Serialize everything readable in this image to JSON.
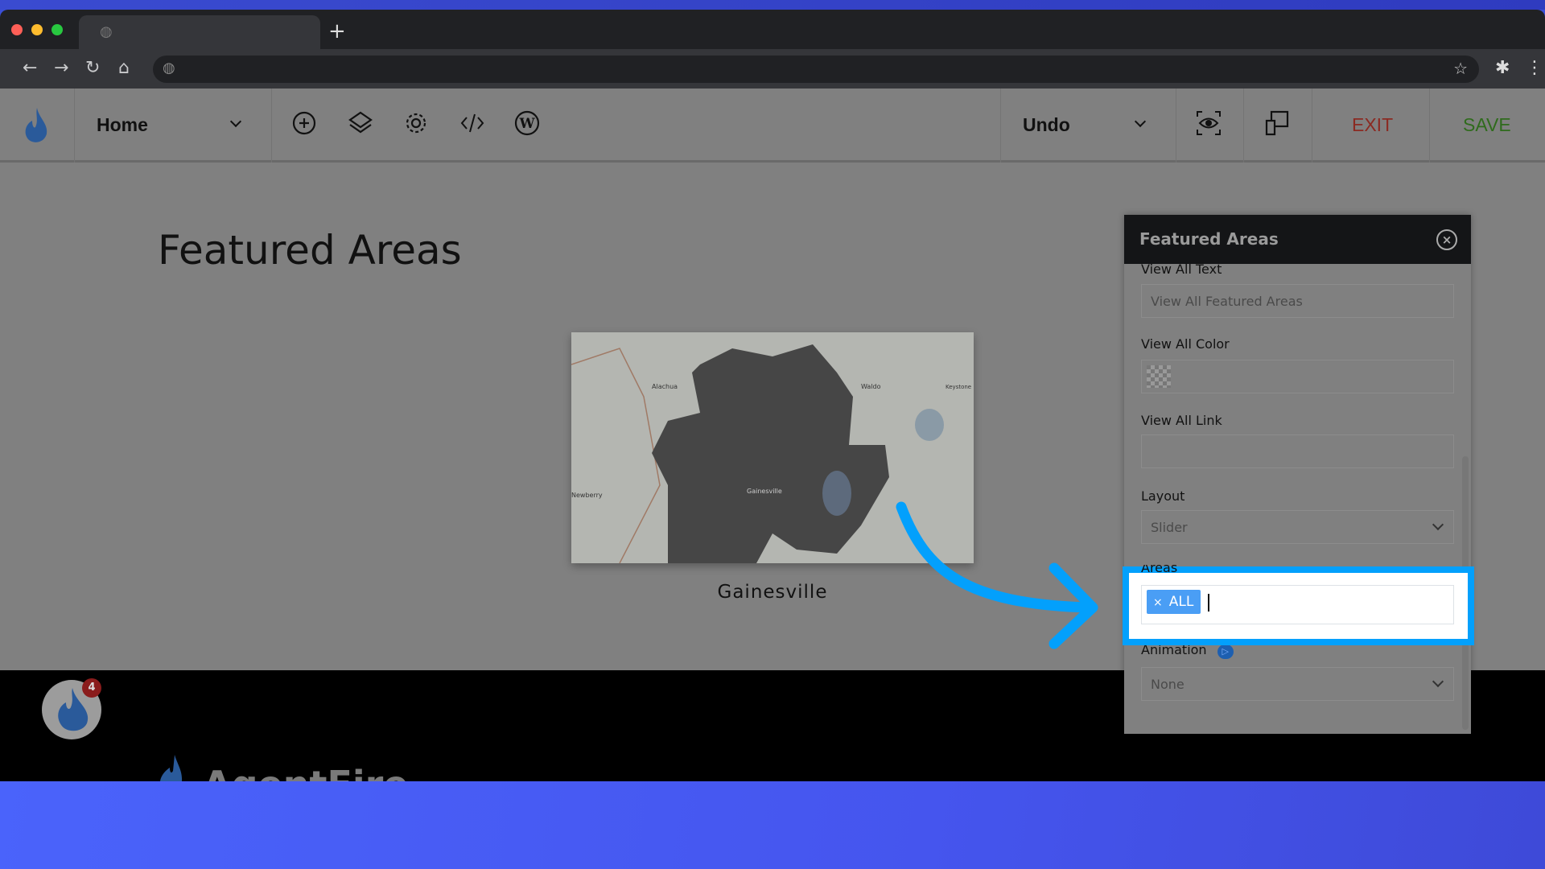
{
  "browser": {
    "new_tab": "+"
  },
  "toolbar": {
    "page": "Home",
    "undo": "Undo",
    "exit": "EXIT",
    "save": "SAVE",
    "exit_color": "#8b2a22",
    "save_color": "#2f6b1c",
    "icons": [
      "plus-circle-icon",
      "layers-icon",
      "gear-icon",
      "code-icon",
      "wordpress-icon",
      "preview-eye-icon",
      "responsive-icon"
    ]
  },
  "main": {
    "title": "Featured Areas",
    "area_name": "Gainesville",
    "map_labels": [
      "Alachua",
      "Waldo",
      "Keystone Heights",
      "Newberry",
      "Gainesville"
    ]
  },
  "panel": {
    "title": "Featured Areas",
    "view_all_text_label": "View All Text",
    "view_all_text_value": "View All Featured Areas",
    "view_all_color_label": "View All Color",
    "view_all_link_label": "View All Link",
    "view_all_link_value": "",
    "layout_label": "Layout",
    "layout_value": "Slider",
    "areas_label": "Areas",
    "areas_chip": "ALL",
    "chip_remove": "×",
    "animation_label": "Animation",
    "animation_value": "None",
    "highlight_color": "#03a0fc"
  },
  "footer": {
    "badge_count": "4",
    "brand": "AgentFire"
  }
}
